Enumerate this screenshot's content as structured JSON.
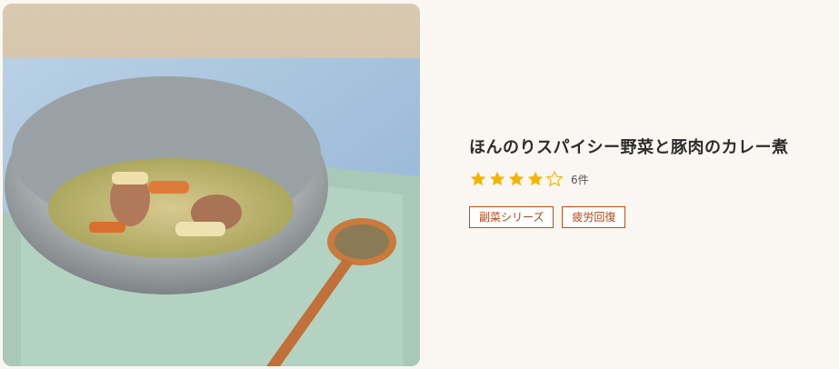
{
  "recipe": {
    "title": "ほんのりスパイシー野菜と豚肉のカレー煮",
    "rating": 4,
    "rating_max": 5,
    "review_count": "6件",
    "tags": [
      "副菜シリーズ",
      "疲労回復"
    ],
    "image_icon": "curry-stew-photo"
  },
  "colors": {
    "star_filled": "#f5b400",
    "star_empty_stroke": "#f5b400",
    "tag_border": "#c44a12",
    "background": "#faf7f2"
  }
}
